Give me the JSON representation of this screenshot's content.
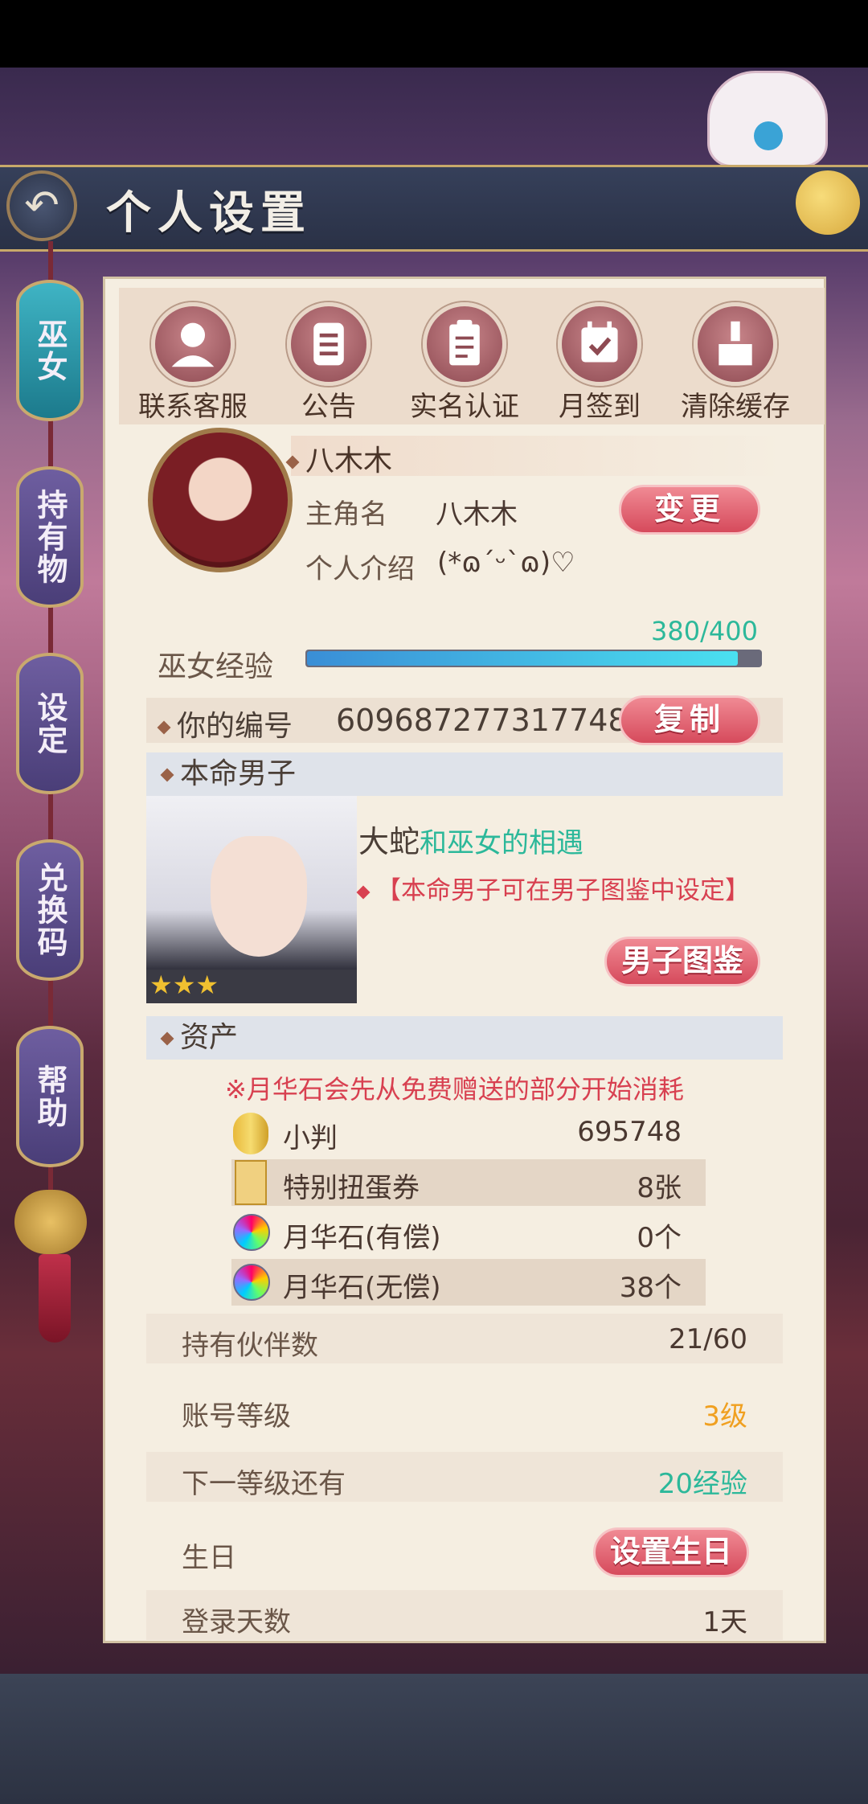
{
  "header": {
    "title": "个人设置",
    "back_glyph": "↶"
  },
  "side_tabs": [
    {
      "label": "巫女",
      "active": true
    },
    {
      "label": "持有物",
      "active": false
    },
    {
      "label": "设定",
      "active": false
    },
    {
      "label": "兑换码",
      "active": false
    },
    {
      "label": "帮助",
      "active": false
    }
  ],
  "top_actions": [
    {
      "label": "联系客服",
      "icon": "customer-service-icon"
    },
    {
      "label": "公告",
      "icon": "announcement-icon"
    },
    {
      "label": "实名认证",
      "icon": "verification-icon"
    },
    {
      "label": "月签到",
      "icon": "calendar-check-icon"
    },
    {
      "label": "清除缓存",
      "icon": "broom-icon"
    }
  ],
  "profile": {
    "name": "八木木",
    "main_role_label": "主角名",
    "main_role_value": "八木木",
    "change_button": "变更",
    "intro_label": "个人介绍",
    "intro_value": "(*ɷ´ᵕ`ɷ)♡",
    "exp_label": "巫女经验",
    "exp_text": "380/400",
    "exp_current": 380,
    "exp_max": 400
  },
  "id_row": {
    "label": "你的编号",
    "value": "609687277317748",
    "copy_button": "复制"
  },
  "partner": {
    "section_title": "本命男子",
    "name": "大蛇",
    "relation": "和巫女的相遇",
    "note": "【本命男子可在男子图鉴中设定】",
    "stars": "★★★",
    "button": "男子图鉴"
  },
  "assets": {
    "section_title": "资产",
    "notice": "※月华石会先从免费赠送的部分开始消耗",
    "items": [
      {
        "name": "小判",
        "value": "695748",
        "icon": "koban-coin-icon"
      },
      {
        "name": "特别扭蛋券",
        "value": "8张",
        "icon": "gacha-ticket-icon"
      },
      {
        "name": "月华石(有偿)",
        "value": "0个",
        "icon": "moonstone-gem-icon"
      },
      {
        "name": "月华石(无偿)",
        "value": "38个",
        "icon": "moonstone-gem-icon"
      }
    ]
  },
  "stats": {
    "partners_label": "持有伙伴数",
    "partners_value": "21/60",
    "level_label": "账号等级",
    "level_value": "3级",
    "next_label": "下一等级还有",
    "next_value": "20经验",
    "birthday_label": "生日",
    "birthday_button": "设置生日",
    "login_label": "登录天数",
    "login_value": "1天"
  },
  "colors": {
    "accent_pink": "#d64a5c",
    "teal_text": "#2cb89a",
    "orange_text": "#f0a020",
    "red_text": "#d84050"
  }
}
